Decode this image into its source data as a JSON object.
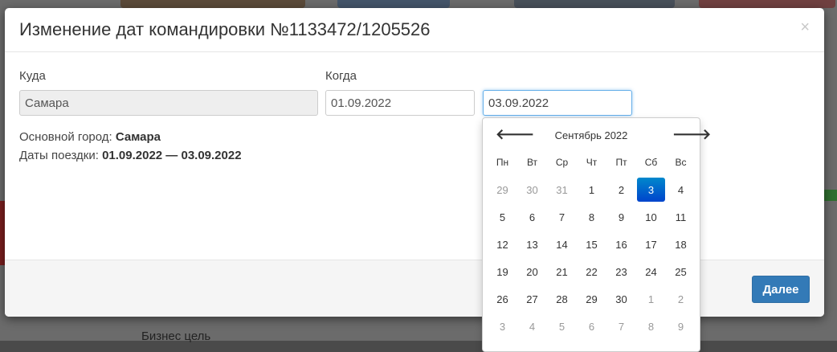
{
  "modal": {
    "title": "Изменение дат командировки №1133472/1205526",
    "close_label": "×"
  },
  "form": {
    "destination_label": "Куда",
    "destination_value": "Самара",
    "when_label": "Когда",
    "date_from": "01.09.2022",
    "date_to": "03.09.2022"
  },
  "info": {
    "main_city_label": "Основной город:",
    "main_city_value": "Самара",
    "trip_dates_label": "Даты поездки:",
    "trip_dates_value": "01.09.2022 — 03.09.2022"
  },
  "footer": {
    "next_label": "Далее"
  },
  "datepicker": {
    "month_label": "Сентябрь 2022",
    "prev_label": "🡐",
    "next_label": "🡒",
    "weekdays": [
      "Пн",
      "Вт",
      "Ср",
      "Чт",
      "Пт",
      "Сб",
      "Вс"
    ],
    "selected_day": "3",
    "weeks": [
      [
        {
          "d": "29",
          "m": true
        },
        {
          "d": "30",
          "m": true
        },
        {
          "d": "31",
          "m": true
        },
        {
          "d": "1"
        },
        {
          "d": "2"
        },
        {
          "d": "3",
          "s": true
        },
        {
          "d": "4"
        }
      ],
      [
        {
          "d": "5"
        },
        {
          "d": "6"
        },
        {
          "d": "7"
        },
        {
          "d": "8"
        },
        {
          "d": "9"
        },
        {
          "d": "10"
        },
        {
          "d": "11"
        }
      ],
      [
        {
          "d": "12"
        },
        {
          "d": "13"
        },
        {
          "d": "14"
        },
        {
          "d": "15"
        },
        {
          "d": "16"
        },
        {
          "d": "17"
        },
        {
          "d": "18"
        }
      ],
      [
        {
          "d": "19"
        },
        {
          "d": "20"
        },
        {
          "d": "21"
        },
        {
          "d": "22"
        },
        {
          "d": "23"
        },
        {
          "d": "24"
        },
        {
          "d": "25"
        }
      ],
      [
        {
          "d": "26"
        },
        {
          "d": "27"
        },
        {
          "d": "28"
        },
        {
          "d": "29"
        },
        {
          "d": "30"
        },
        {
          "d": "1",
          "m": true
        },
        {
          "d": "2",
          "m": true
        }
      ],
      [
        {
          "d": "3",
          "m": true
        },
        {
          "d": "4",
          "m": true
        },
        {
          "d": "5",
          "m": true
        },
        {
          "d": "6",
          "m": true
        },
        {
          "d": "7",
          "m": true
        },
        {
          "d": "8",
          "m": true
        },
        {
          "d": "9",
          "m": true
        }
      ]
    ]
  },
  "background": {
    "business_goal_label": "Бизнес цель"
  }
}
